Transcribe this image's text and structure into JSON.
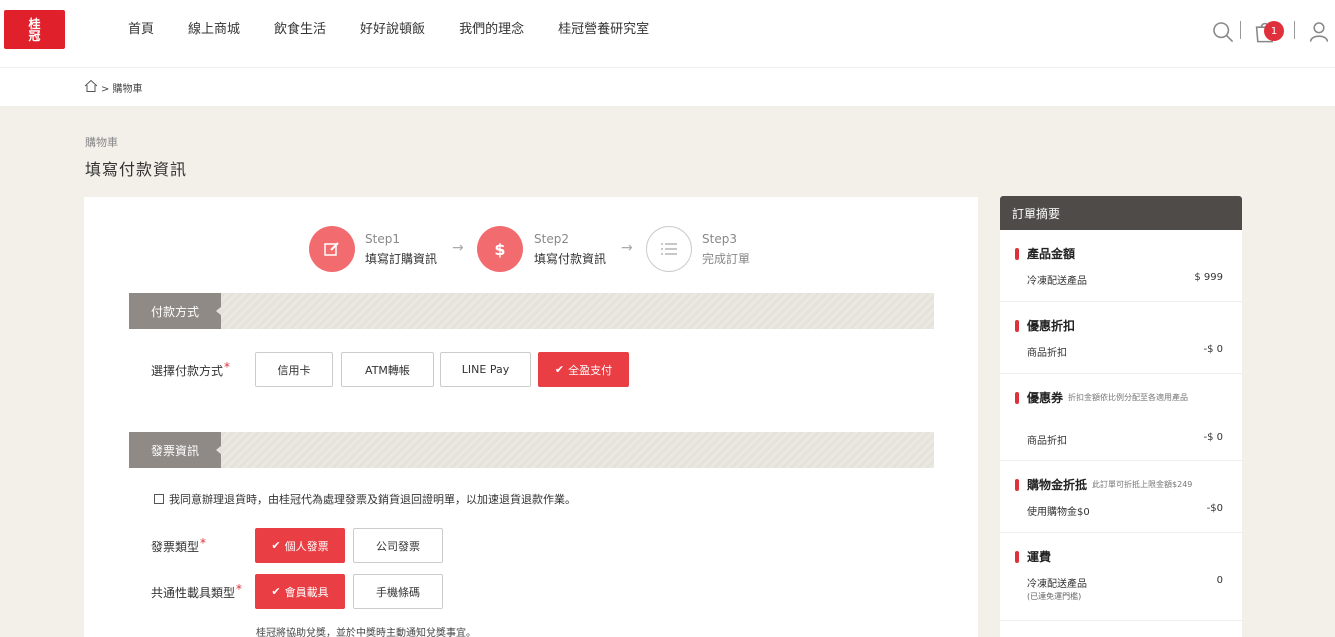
{
  "logo": {
    "text_line1": "桂",
    "text_line2": "冠"
  },
  "nav": [
    "首頁",
    "線上商城",
    "飲食生活",
    "好好說頓飯",
    "我們的理念",
    "桂冠營養研究室"
  ],
  "header": {
    "cart_count": "1"
  },
  "breadcrumb": {
    "text": "> 購物車"
  },
  "page": {
    "sub": "購物車",
    "title": "填寫付款資訊"
  },
  "steps": [
    {
      "label": "Step1",
      "name": "填寫訂購資訊"
    },
    {
      "label": "Step2",
      "name": "填寫付款資訊"
    },
    {
      "label": "Step3",
      "name": "完成訂單"
    }
  ],
  "payment": {
    "section": "付款方式",
    "label": "選擇付款方式",
    "options": [
      "信用卡",
      "ATM轉帳",
      "LINE Pay",
      "全盈支付"
    ],
    "selected": "全盈支付"
  },
  "invoice": {
    "section": "發票資訊",
    "agree": "我同意辦理退貨時，由桂冠代為處理發票及銷貨退回證明單，以加速退貨退款作業。",
    "type_label": "發票類型",
    "types": [
      "個人發票",
      "公司發票"
    ],
    "carrier_label": "共通性載具類型",
    "carriers": [
      "會員載具",
      "手機條碼"
    ],
    "note": "桂冠將協助兌獎，並於中獎時主動通知兌獎事宜。"
  },
  "summary": {
    "title": "訂單摘要",
    "sections": [
      {
        "title": "產品金額",
        "hint": "",
        "row_label": "冷凍配送產品",
        "row_value": "$ 999",
        "sub": ""
      },
      {
        "title": "優惠折扣",
        "hint": "",
        "row_label": "商品折扣",
        "row_value": "-$ 0",
        "sub": ""
      },
      {
        "title": "優惠券",
        "hint": "折扣金額依比例分配至各適用產品",
        "row_label": "商品折扣",
        "row_value": "-$ 0",
        "sub": ""
      },
      {
        "title": "購物金折抵",
        "hint": "此訂單可折抵上限金額$249",
        "row_label": "使用購物金$0",
        "row_value": "-$0",
        "sub": ""
      },
      {
        "title": "運費",
        "hint": "",
        "row_label": "冷凍配送產品",
        "row_value": "0",
        "sub": "(已達免運門檻)"
      }
    ]
  },
  "colors": {
    "brand": "#e0202b",
    "accent": "#e83e44",
    "step_active": "#f16b6f"
  }
}
